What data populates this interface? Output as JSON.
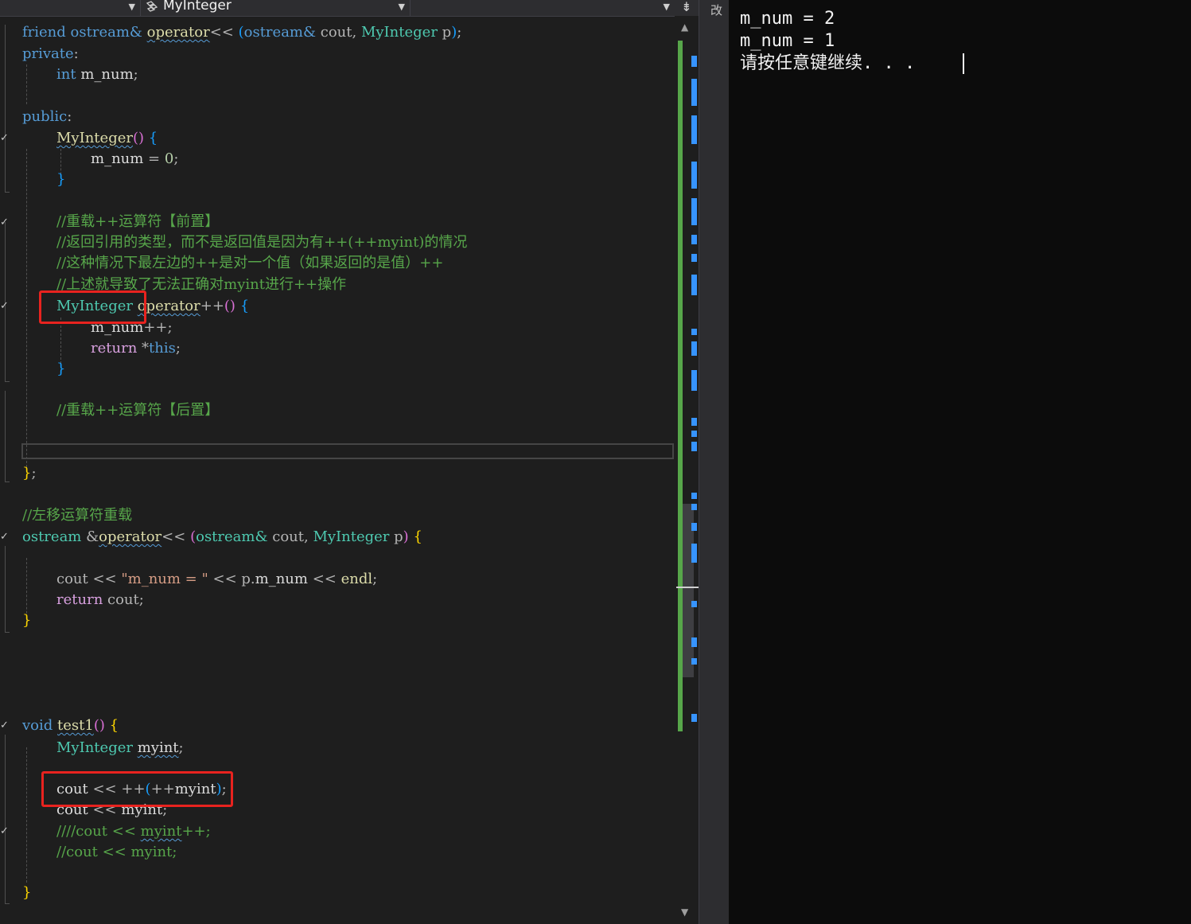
{
  "navbar": {
    "class_scope": "MyInteger"
  },
  "side_tab": "改",
  "code": {
    "l1": [
      "friend",
      " ",
      "ostream&",
      " ",
      "operator",
      "<<",
      " ",
      "(",
      "ostream&",
      " ",
      "cout",
      ", ",
      "MyInteger",
      " ",
      "p",
      ")",
      ";"
    ],
    "l2": [
      "private",
      ":"
    ],
    "l3": [
      "int",
      " ",
      "m_num",
      ";"
    ],
    "l4": [
      "public",
      ":"
    ],
    "l5": [
      "MyInteger",
      "()",
      " ",
      "{"
    ],
    "l6": [
      "m_num",
      " = ",
      "0",
      ";"
    ],
    "l7": [
      "}"
    ],
    "l8": "//重载++运算符【前置】",
    "l9": "//返回引用的类型，而不是返回值是因为有++(++myint)的情况",
    "l10": "//这种情况下最左边的++是对一个值（如果返回的是值）++",
    "l11": "//上述就导致了无法正确对myint进行++操作",
    "l12": [
      "MyInteger",
      " ",
      "operator",
      "++",
      "()",
      " ",
      "{"
    ],
    "l13": [
      "m_num",
      "++",
      ";"
    ],
    "l14": [
      "return",
      " ",
      "*",
      "this",
      ";"
    ],
    "l15": [
      "}"
    ],
    "l16": "//重载++运算符【后置】",
    "l17": [
      "}",
      ";"
    ],
    "l18": "//左移运算符重载",
    "l19": [
      "ostream",
      " ",
      "&",
      "operator",
      "<<",
      " ",
      "(",
      "ostream&",
      " ",
      "cout",
      ", ",
      "MyInteger",
      " ",
      "p",
      ")",
      " ",
      "{"
    ],
    "l20": [
      "cout",
      " << ",
      "\"m_num = \"",
      " << ",
      "p",
      ".",
      "m_num",
      " << ",
      "endl",
      ";"
    ],
    "l21": [
      "return",
      " ",
      "cout",
      ";"
    ],
    "l22": [
      "}"
    ],
    "l23": [
      "void",
      " ",
      "test1",
      "()",
      " ",
      "{"
    ],
    "l24": [
      "MyInteger",
      " ",
      "myint",
      ";"
    ],
    "l25": [
      "cout",
      " << ",
      "++",
      "(",
      "++",
      "myint",
      ")",
      ";"
    ],
    "l26": [
      "cout",
      " << ",
      "myint",
      ";"
    ],
    "l27": [
      "////cout",
      " << ",
      "myint",
      "++;"
    ],
    "l28": [
      "//cout",
      " << ",
      "myint",
      ";"
    ],
    "l29": [
      "}"
    ]
  },
  "console": {
    "lines": [
      "m_num = 2",
      "m_num = 1",
      "请按任意键继续. . ."
    ]
  },
  "colors": {
    "editor_bg": "#1e1e1e",
    "keyword": "#569cd6",
    "type": "#4ec9b0",
    "comment": "#57a64a",
    "highlight_box": "#e8231f",
    "console_bg": "#0c0c0c"
  }
}
